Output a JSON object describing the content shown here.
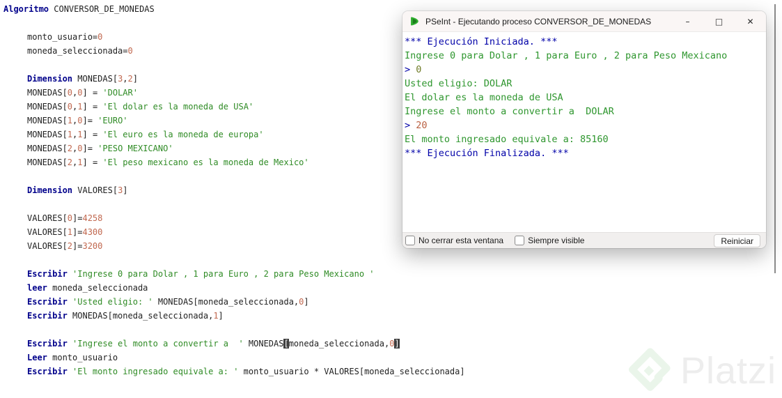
{
  "colors": {
    "keyword": "#00008b",
    "plain": "#1f1f1f",
    "number": "#c1684f",
    "string": "#2f8b25",
    "console_blue": "#0000a8",
    "console_green": "#2e962e",
    "console_olive": "#707c28",
    "console_salmon": "#b95f41"
  },
  "editor": {
    "code_lines": [
      {
        "indent": 0,
        "segments": [
          {
            "text": "Algoritmo",
            "style": "keyword"
          },
          {
            "text": " CONVERSOR_DE_MONEDAS",
            "style": "plain"
          }
        ]
      },
      {
        "indent": 1,
        "segments": []
      },
      {
        "indent": 1,
        "segments": [
          {
            "text": "monto_usuario=",
            "style": "plain"
          },
          {
            "text": "0",
            "style": "number"
          }
        ]
      },
      {
        "indent": 1,
        "segments": [
          {
            "text": "moneda_seleccionada=",
            "style": "plain"
          },
          {
            "text": "0",
            "style": "number"
          }
        ]
      },
      {
        "indent": 1,
        "segments": []
      },
      {
        "indent": 1,
        "segments": [
          {
            "text": "Dimension",
            "style": "keyword"
          },
          {
            "text": " MONEDAS[",
            "style": "plain"
          },
          {
            "text": "3",
            "style": "number"
          },
          {
            "text": ",",
            "style": "plain"
          },
          {
            "text": "2",
            "style": "number"
          },
          {
            "text": "]",
            "style": "plain"
          }
        ]
      },
      {
        "indent": 1,
        "segments": [
          {
            "text": "MONEDAS[",
            "style": "plain"
          },
          {
            "text": "0",
            "style": "number"
          },
          {
            "text": ",",
            "style": "plain"
          },
          {
            "text": "0",
            "style": "number"
          },
          {
            "text": "] = ",
            "style": "plain"
          },
          {
            "text": "'DOLAR'",
            "style": "string"
          }
        ]
      },
      {
        "indent": 1,
        "segments": [
          {
            "text": "MONEDAS[",
            "style": "plain"
          },
          {
            "text": "0",
            "style": "number"
          },
          {
            "text": ",",
            "style": "plain"
          },
          {
            "text": "1",
            "style": "number"
          },
          {
            "text": "] = ",
            "style": "plain"
          },
          {
            "text": "'El dolar es la moneda de USA'",
            "style": "string"
          }
        ]
      },
      {
        "indent": 1,
        "segments": [
          {
            "text": "MONEDAS[",
            "style": "plain"
          },
          {
            "text": "1",
            "style": "number"
          },
          {
            "text": ",",
            "style": "plain"
          },
          {
            "text": "0",
            "style": "number"
          },
          {
            "text": "]= ",
            "style": "plain"
          },
          {
            "text": "'EURO'",
            "style": "string"
          }
        ]
      },
      {
        "indent": 1,
        "segments": [
          {
            "text": "MONEDAS[",
            "style": "plain"
          },
          {
            "text": "1",
            "style": "number"
          },
          {
            "text": ",",
            "style": "plain"
          },
          {
            "text": "1",
            "style": "number"
          },
          {
            "text": "] = ",
            "style": "plain"
          },
          {
            "text": "'El euro es la moneda de europa'",
            "style": "string"
          }
        ]
      },
      {
        "indent": 1,
        "segments": [
          {
            "text": "MONEDAS[",
            "style": "plain"
          },
          {
            "text": "2",
            "style": "number"
          },
          {
            "text": ",",
            "style": "plain"
          },
          {
            "text": "0",
            "style": "number"
          },
          {
            "text": "]= ",
            "style": "plain"
          },
          {
            "text": "'PESO MEXICANO'",
            "style": "string"
          }
        ]
      },
      {
        "indent": 1,
        "segments": [
          {
            "text": "MONEDAS[",
            "style": "plain"
          },
          {
            "text": "2",
            "style": "number"
          },
          {
            "text": ",",
            "style": "plain"
          },
          {
            "text": "1",
            "style": "number"
          },
          {
            "text": "] = ",
            "style": "plain"
          },
          {
            "text": "'El peso mexicano es la moneda de Mexico'",
            "style": "string"
          }
        ]
      },
      {
        "indent": 1,
        "segments": []
      },
      {
        "indent": 1,
        "segments": [
          {
            "text": "Dimension",
            "style": "keyword"
          },
          {
            "text": " VALORES[",
            "style": "plain"
          },
          {
            "text": "3",
            "style": "number"
          },
          {
            "text": "]",
            "style": "plain"
          }
        ]
      },
      {
        "indent": 1,
        "segments": []
      },
      {
        "indent": 1,
        "segments": [
          {
            "text": "VALORES[",
            "style": "plain"
          },
          {
            "text": "0",
            "style": "number"
          },
          {
            "text": "]=",
            "style": "plain"
          },
          {
            "text": "4258",
            "style": "number"
          }
        ]
      },
      {
        "indent": 1,
        "segments": [
          {
            "text": "VALORES[",
            "style": "plain"
          },
          {
            "text": "1",
            "style": "number"
          },
          {
            "text": "]=",
            "style": "plain"
          },
          {
            "text": "4300",
            "style": "number"
          }
        ]
      },
      {
        "indent": 1,
        "segments": [
          {
            "text": "VALORES[",
            "style": "plain"
          },
          {
            "text": "2",
            "style": "number"
          },
          {
            "text": "]=",
            "style": "plain"
          },
          {
            "text": "3200",
            "style": "number"
          }
        ]
      },
      {
        "indent": 1,
        "segments": []
      },
      {
        "indent": 1,
        "segments": [
          {
            "text": "Escribir",
            "style": "keyword"
          },
          {
            "text": " ",
            "style": "plain"
          },
          {
            "text": "'Ingrese 0 para Dolar , 1 para Euro , 2 para Peso Mexicano '",
            "style": "string"
          }
        ]
      },
      {
        "indent": 1,
        "segments": [
          {
            "text": "leer",
            "style": "keyword"
          },
          {
            "text": " moneda_seleccionada",
            "style": "plain"
          }
        ]
      },
      {
        "indent": 1,
        "segments": [
          {
            "text": "Escribir",
            "style": "keyword"
          },
          {
            "text": " ",
            "style": "plain"
          },
          {
            "text": "'Usted eligio: '",
            "style": "string"
          },
          {
            "text": " MONEDAS[moneda_seleccionada,",
            "style": "plain"
          },
          {
            "text": "0",
            "style": "number"
          },
          {
            "text": "]",
            "style": "plain"
          }
        ]
      },
      {
        "indent": 1,
        "segments": [
          {
            "text": "Escribir",
            "style": "keyword"
          },
          {
            "text": " MONEDAS[moneda_seleccionada,",
            "style": "plain"
          },
          {
            "text": "1",
            "style": "number"
          },
          {
            "text": "]",
            "style": "plain"
          }
        ]
      },
      {
        "indent": 1,
        "segments": []
      },
      {
        "indent": 1,
        "segments": [
          {
            "text": "Escribir",
            "style": "keyword"
          },
          {
            "text": " ",
            "style": "plain"
          },
          {
            "text": "'Ingrese el monto a convertir a  '",
            "style": "string"
          },
          {
            "text": " MONEDAS",
            "style": "plain"
          },
          {
            "text": "[",
            "style": "bracket"
          },
          {
            "text": "moneda_seleccionada,",
            "style": "plain"
          },
          {
            "text": "0",
            "style": "number"
          },
          {
            "text": "]",
            "style": "bracket"
          }
        ]
      },
      {
        "indent": 1,
        "segments": [
          {
            "text": "Leer",
            "style": "keyword"
          },
          {
            "text": " monto_usuario",
            "style": "plain"
          }
        ]
      },
      {
        "indent": 1,
        "segments": [
          {
            "text": "Escribir",
            "style": "keyword"
          },
          {
            "text": " ",
            "style": "plain"
          },
          {
            "text": "'El monto ingresado equivale a: '",
            "style": "string"
          },
          {
            "text": " monto_usuario * VALORES[moneda_seleccionada]",
            "style": "plain"
          }
        ]
      }
    ]
  },
  "console_window": {
    "title": "PSeInt - Ejecutando proceso CONVERSOR_DE_MONEDAS",
    "window_buttons": {
      "minimize": "–",
      "maximize": "□",
      "close": "✕"
    },
    "output_lines": [
      [
        {
          "text": "*** Ejecución Iniciada. ***",
          "style": "blue"
        }
      ],
      [
        {
          "text": "Ingrese 0 para Dolar , 1 para Euro , 2 para Peso Mexicano",
          "style": "green"
        }
      ],
      [
        {
          "text": "> ",
          "style": "blue"
        },
        {
          "text": "0",
          "style": "olive"
        }
      ],
      [
        {
          "text": "Usted eligio: DOLAR",
          "style": "green"
        }
      ],
      [
        {
          "text": "El dolar es la moneda de USA",
          "style": "green"
        }
      ],
      [
        {
          "text": "Ingrese el monto a convertir a  DOLAR",
          "style": "green"
        }
      ],
      [
        {
          "text": "> ",
          "style": "blue"
        },
        {
          "text": "20",
          "style": "salmon"
        }
      ],
      [
        {
          "text": "El monto ingresado equivale a: 85160",
          "style": "green"
        }
      ],
      [
        {
          "text": "*** Ejecución Finalizada. ***",
          "style": "blue"
        }
      ]
    ],
    "footer": {
      "checkboxes": [
        {
          "label": "No cerrar esta ventana",
          "checked": false
        },
        {
          "label": "Siempre visible",
          "checked": false
        }
      ],
      "restart_label": "Reiniciar"
    }
  },
  "watermark": {
    "text": "Platzi"
  }
}
